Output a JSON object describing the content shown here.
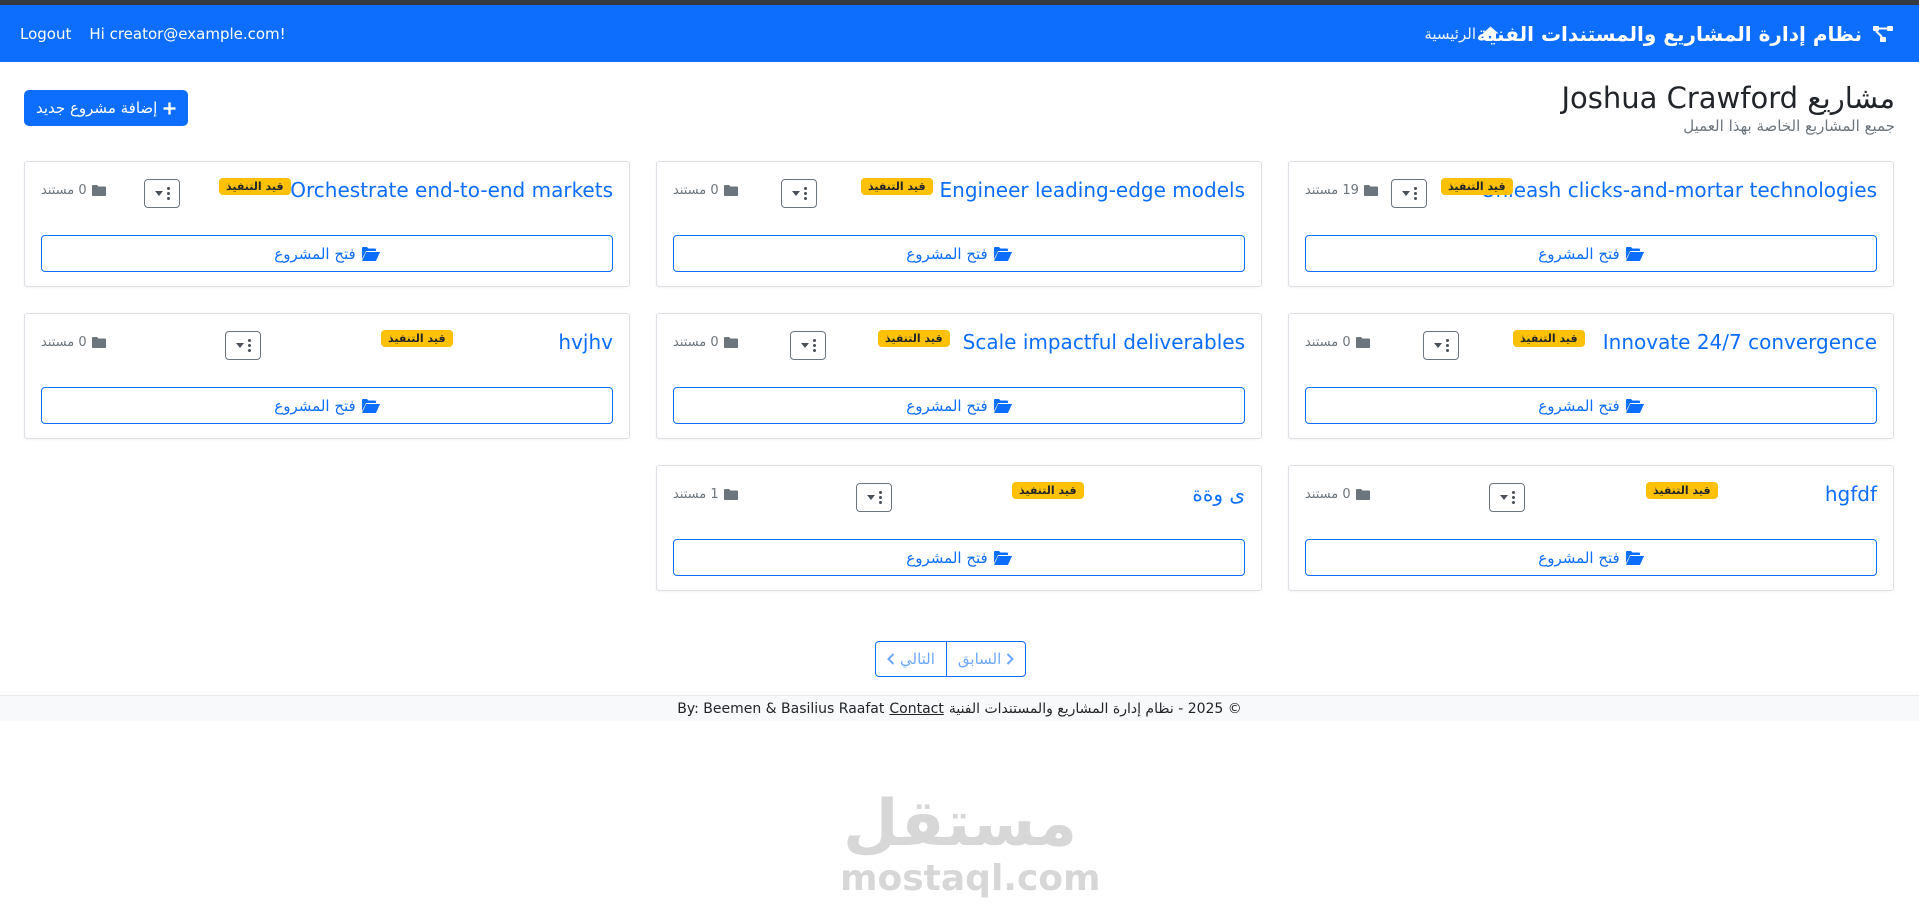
{
  "navbar": {
    "brand_title": "نظام إدارة المشاريع والمستندات الفنية",
    "home_label": "الرئيسية",
    "user_greeting": "Hi creator@example.com!",
    "logout_label": "Logout",
    "bg_color": "#0d6efd"
  },
  "page": {
    "title": "مشاريع Joshua Crawford",
    "subtitle": "جميع المشاريع الخاصة بهذا العميل",
    "add_button_label": "إضافة مشروع جديد"
  },
  "projects": [
    {
      "title": "Unleash clicks-and-mortar technologies",
      "status": "قيد التنفيذ",
      "doc_count": "19 مستند",
      "open_label": "فتح المشروع"
    },
    {
      "title": "Engineer leading-edge models",
      "status": "قيد التنفيذ",
      "doc_count": "0 مستند",
      "open_label": "فتح المشروع"
    },
    {
      "title": "Orchestrate end-to-end markets",
      "status": "قيد التنفيذ",
      "doc_count": "0 مستند",
      "open_label": "فتح المشروع"
    },
    {
      "title": "Innovate 24/7 convergence",
      "status": "قيد التنفيذ",
      "doc_count": "0 مستند",
      "open_label": "فتح المشروع"
    },
    {
      "title": "Scale impactful deliverables",
      "status": "قيد التنفيذ",
      "doc_count": "0 مستند",
      "open_label": "فتح المشروع"
    },
    {
      "title": "hvjhv",
      "status": "قيد التنفيذ",
      "doc_count": "0 مستند",
      "open_label": "فتح المشروع"
    },
    {
      "title": "hgfdf",
      "status": "قيد التنفيذ",
      "doc_count": "0 مستند",
      "open_label": "فتح المشروع"
    },
    {
      "title": "ى وةة",
      "status": "قيد التنفيذ",
      "doc_count": "1 مستند",
      "open_label": "فتح المشروع"
    }
  ],
  "pagination": {
    "prev_label": "السابق",
    "next_label": "التالي"
  },
  "footer": {
    "copyright": "© 2025 - نظام إدارة المشاريع والمستندات الفنية",
    "contact_label": "Contact",
    "credits": "By: Beemen & Basilius Raafat"
  },
  "watermark": {
    "arabic": "مستقل",
    "latin": "mostaql.com"
  },
  "colors": {
    "primary": "#0d6efd",
    "status_badge": "#ffc107",
    "muted": "#6c757d"
  }
}
